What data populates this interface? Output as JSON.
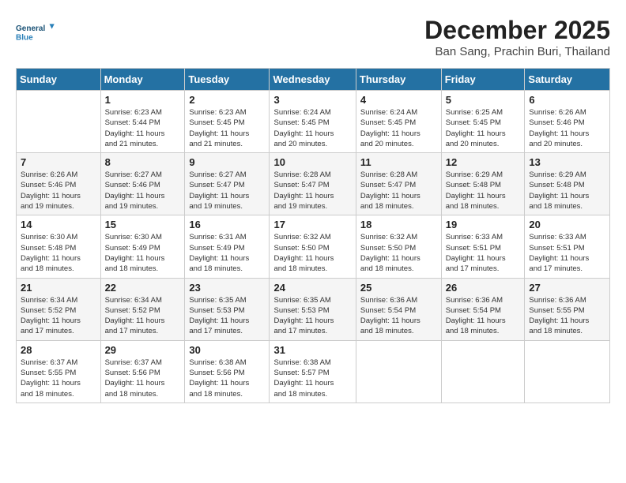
{
  "logo": {
    "line1": "General",
    "line2": "Blue"
  },
  "title": "December 2025",
  "subtitle": "Ban Sang, Prachin Buri, Thailand",
  "weekdays": [
    "Sunday",
    "Monday",
    "Tuesday",
    "Wednesday",
    "Thursday",
    "Friday",
    "Saturday"
  ],
  "weeks": [
    [
      {
        "day": "",
        "info": ""
      },
      {
        "day": "1",
        "info": "Sunrise: 6:23 AM\nSunset: 5:44 PM\nDaylight: 11 hours\nand 21 minutes."
      },
      {
        "day": "2",
        "info": "Sunrise: 6:23 AM\nSunset: 5:45 PM\nDaylight: 11 hours\nand 21 minutes."
      },
      {
        "day": "3",
        "info": "Sunrise: 6:24 AM\nSunset: 5:45 PM\nDaylight: 11 hours\nand 20 minutes."
      },
      {
        "day": "4",
        "info": "Sunrise: 6:24 AM\nSunset: 5:45 PM\nDaylight: 11 hours\nand 20 minutes."
      },
      {
        "day": "5",
        "info": "Sunrise: 6:25 AM\nSunset: 5:45 PM\nDaylight: 11 hours\nand 20 minutes."
      },
      {
        "day": "6",
        "info": "Sunrise: 6:26 AM\nSunset: 5:46 PM\nDaylight: 11 hours\nand 20 minutes."
      }
    ],
    [
      {
        "day": "7",
        "info": "Sunrise: 6:26 AM\nSunset: 5:46 PM\nDaylight: 11 hours\nand 19 minutes."
      },
      {
        "day": "8",
        "info": "Sunrise: 6:27 AM\nSunset: 5:46 PM\nDaylight: 11 hours\nand 19 minutes."
      },
      {
        "day": "9",
        "info": "Sunrise: 6:27 AM\nSunset: 5:47 PM\nDaylight: 11 hours\nand 19 minutes."
      },
      {
        "day": "10",
        "info": "Sunrise: 6:28 AM\nSunset: 5:47 PM\nDaylight: 11 hours\nand 19 minutes."
      },
      {
        "day": "11",
        "info": "Sunrise: 6:28 AM\nSunset: 5:47 PM\nDaylight: 11 hours\nand 18 minutes."
      },
      {
        "day": "12",
        "info": "Sunrise: 6:29 AM\nSunset: 5:48 PM\nDaylight: 11 hours\nand 18 minutes."
      },
      {
        "day": "13",
        "info": "Sunrise: 6:29 AM\nSunset: 5:48 PM\nDaylight: 11 hours\nand 18 minutes."
      }
    ],
    [
      {
        "day": "14",
        "info": "Sunrise: 6:30 AM\nSunset: 5:48 PM\nDaylight: 11 hours\nand 18 minutes."
      },
      {
        "day": "15",
        "info": "Sunrise: 6:30 AM\nSunset: 5:49 PM\nDaylight: 11 hours\nand 18 minutes."
      },
      {
        "day": "16",
        "info": "Sunrise: 6:31 AM\nSunset: 5:49 PM\nDaylight: 11 hours\nand 18 minutes."
      },
      {
        "day": "17",
        "info": "Sunrise: 6:32 AM\nSunset: 5:50 PM\nDaylight: 11 hours\nand 18 minutes."
      },
      {
        "day": "18",
        "info": "Sunrise: 6:32 AM\nSunset: 5:50 PM\nDaylight: 11 hours\nand 18 minutes."
      },
      {
        "day": "19",
        "info": "Sunrise: 6:33 AM\nSunset: 5:51 PM\nDaylight: 11 hours\nand 17 minutes."
      },
      {
        "day": "20",
        "info": "Sunrise: 6:33 AM\nSunset: 5:51 PM\nDaylight: 11 hours\nand 17 minutes."
      }
    ],
    [
      {
        "day": "21",
        "info": "Sunrise: 6:34 AM\nSunset: 5:52 PM\nDaylight: 11 hours\nand 17 minutes."
      },
      {
        "day": "22",
        "info": "Sunrise: 6:34 AM\nSunset: 5:52 PM\nDaylight: 11 hours\nand 17 minutes."
      },
      {
        "day": "23",
        "info": "Sunrise: 6:35 AM\nSunset: 5:53 PM\nDaylight: 11 hours\nand 17 minutes."
      },
      {
        "day": "24",
        "info": "Sunrise: 6:35 AM\nSunset: 5:53 PM\nDaylight: 11 hours\nand 17 minutes."
      },
      {
        "day": "25",
        "info": "Sunrise: 6:36 AM\nSunset: 5:54 PM\nDaylight: 11 hours\nand 18 minutes."
      },
      {
        "day": "26",
        "info": "Sunrise: 6:36 AM\nSunset: 5:54 PM\nDaylight: 11 hours\nand 18 minutes."
      },
      {
        "day": "27",
        "info": "Sunrise: 6:36 AM\nSunset: 5:55 PM\nDaylight: 11 hours\nand 18 minutes."
      }
    ],
    [
      {
        "day": "28",
        "info": "Sunrise: 6:37 AM\nSunset: 5:55 PM\nDaylight: 11 hours\nand 18 minutes."
      },
      {
        "day": "29",
        "info": "Sunrise: 6:37 AM\nSunset: 5:56 PM\nDaylight: 11 hours\nand 18 minutes."
      },
      {
        "day": "30",
        "info": "Sunrise: 6:38 AM\nSunset: 5:56 PM\nDaylight: 11 hours\nand 18 minutes."
      },
      {
        "day": "31",
        "info": "Sunrise: 6:38 AM\nSunset: 5:57 PM\nDaylight: 11 hours\nand 18 minutes."
      },
      {
        "day": "",
        "info": ""
      },
      {
        "day": "",
        "info": ""
      },
      {
        "day": "",
        "info": ""
      }
    ]
  ]
}
